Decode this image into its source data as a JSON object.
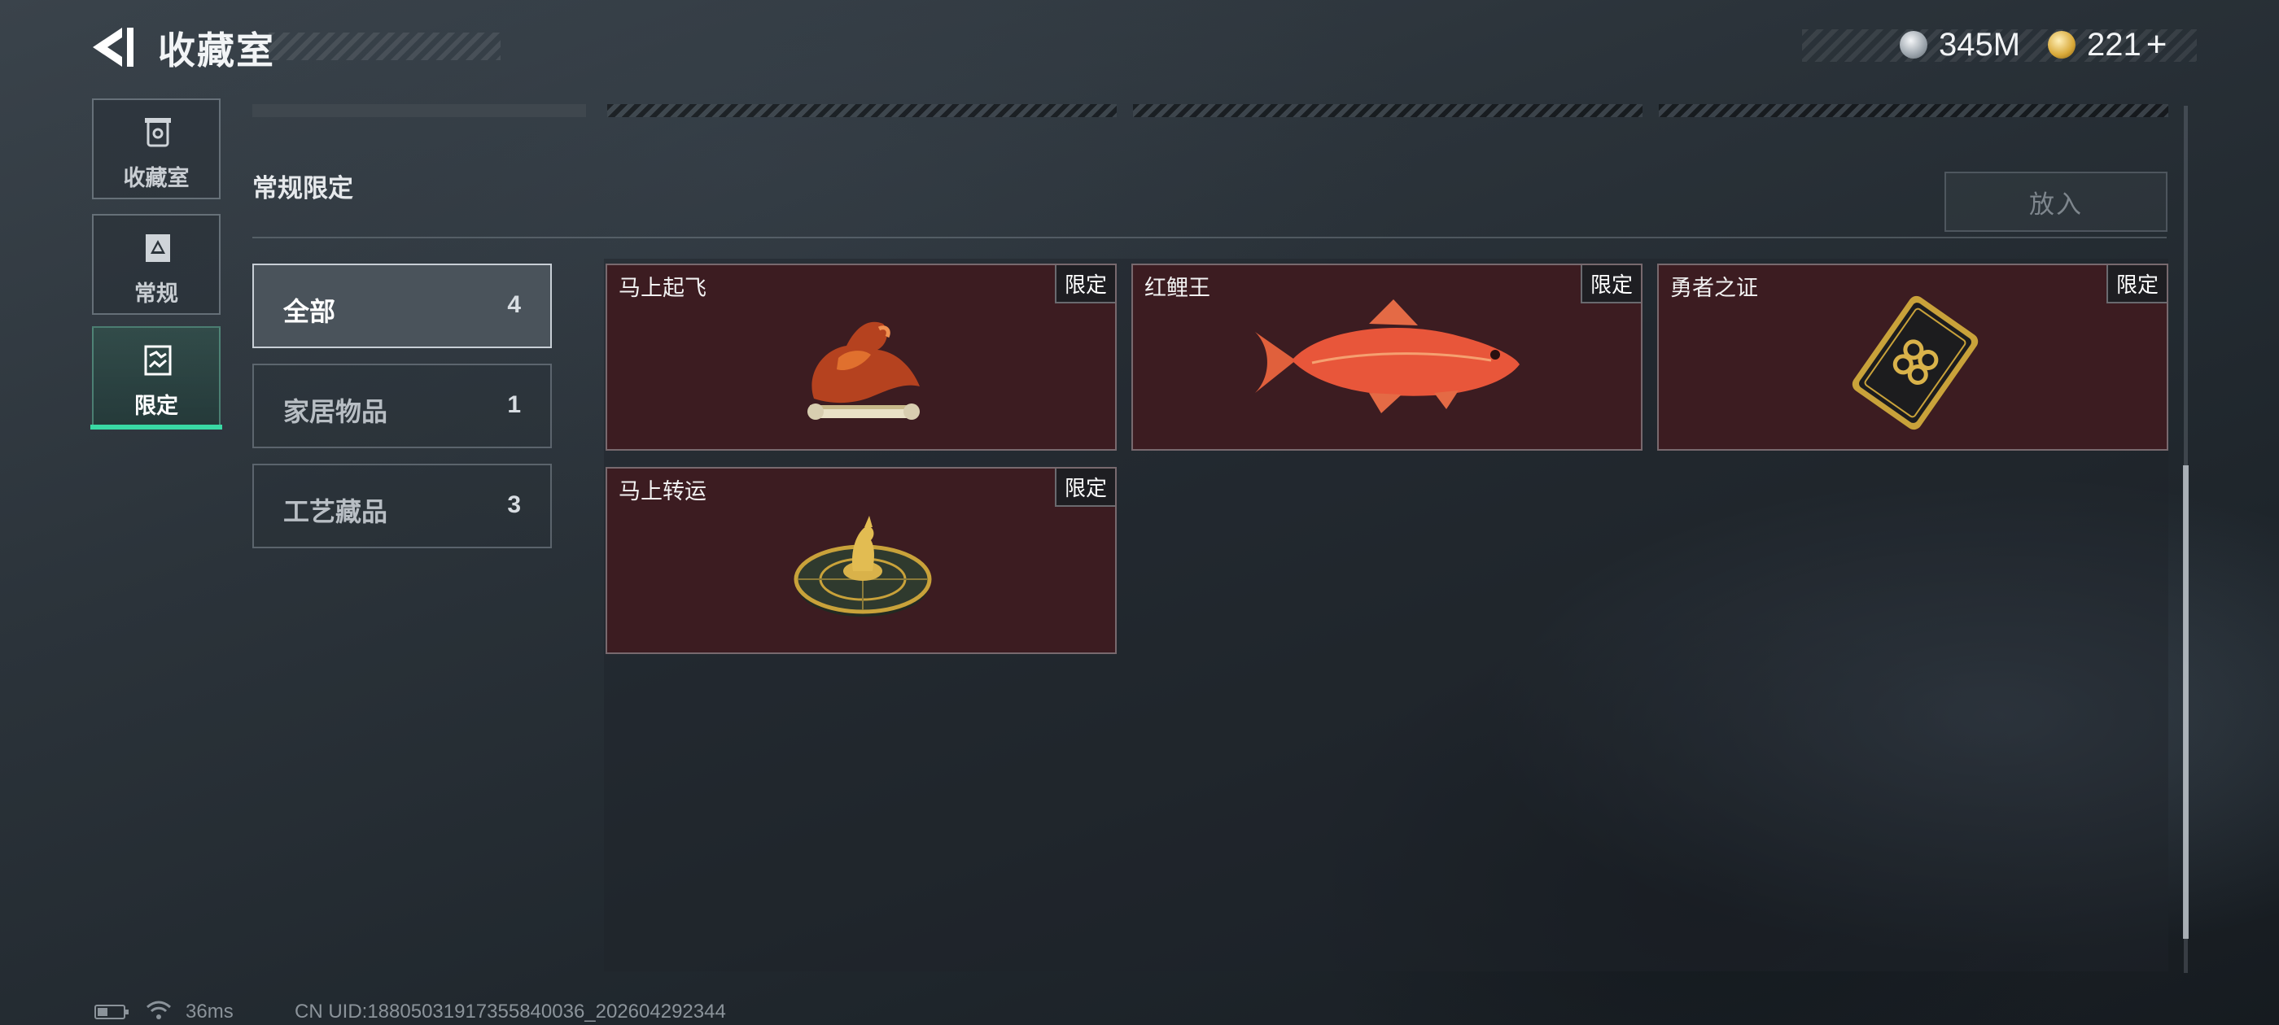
{
  "header": {
    "title": "收藏室",
    "currencies": [
      {
        "icon": "silver-coin-icon",
        "value": "345M"
      },
      {
        "icon": "gold-triangle-coin-icon",
        "value": "221",
        "add_symbol": "+"
      }
    ]
  },
  "sidebar": {
    "items": [
      {
        "label": "收藏室",
        "icon": "collection-room-icon",
        "active": false
      },
      {
        "label": "常规",
        "icon": "regular-card-icon",
        "active": false
      },
      {
        "label": "限定",
        "icon": "limited-map-icon",
        "active": true
      }
    ]
  },
  "main": {
    "section_title": "常规限定",
    "put_in_label": "放入",
    "filters": [
      {
        "label": "全部",
        "count": "4",
        "active": true
      },
      {
        "label": "家居物品",
        "count": "1",
        "active": false
      },
      {
        "label": "工艺藏品",
        "count": "3",
        "active": false
      }
    ],
    "items": [
      {
        "name": "马上起飞",
        "badge": "限定",
        "art": "horse-figurine-icon"
      },
      {
        "name": "红鲤王",
        "badge": "限定",
        "art": "red-carp-icon"
      },
      {
        "name": "勇者之证",
        "badge": "限定",
        "art": "gold-card-icon"
      },
      {
        "name": "马上转运",
        "badge": "限定",
        "art": "fortune-dial-icon"
      }
    ]
  },
  "footer": {
    "latency": "36ms",
    "uid": "CN UID:18805031917355840036_202604292344"
  },
  "colors": {
    "accent": "#39d9a4",
    "card_bg": "#3c1c21"
  }
}
